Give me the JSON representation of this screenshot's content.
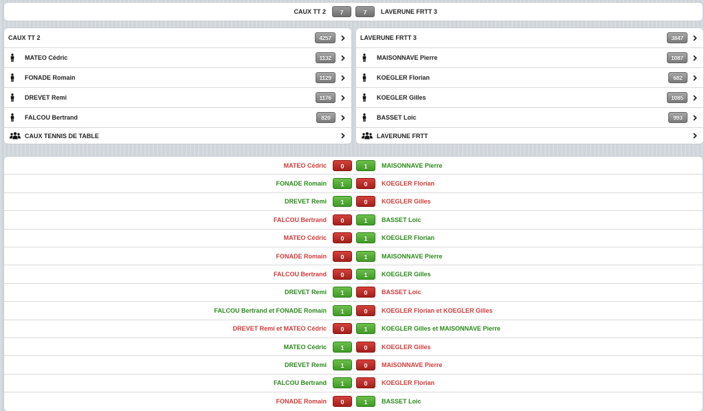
{
  "header": {
    "home": "CAUX TT 2",
    "home_score": "7",
    "away_score": "7",
    "away": "LAVERUNE FRTT 3"
  },
  "teams": {
    "left": {
      "name": "CAUX TT 2",
      "points": "4257",
      "players": [
        {
          "name": "MATEO Cédric",
          "points": "1132"
        },
        {
          "name": "FONADE Romain",
          "points": "1129"
        },
        {
          "name": "DREVET Remi",
          "points": "1176"
        },
        {
          "name": "FALCOU Bertrand",
          "points": "820"
        }
      ],
      "club": "CAUX TENNIS DE TABLE"
    },
    "right": {
      "name": "LAVERUNE FRTT 3",
      "points": "3847",
      "players": [
        {
          "name": "MAISONNAVE Pierre",
          "points": "1087"
        },
        {
          "name": "KOEGLER Florian",
          "points": "682"
        },
        {
          "name": "KOEGLER Gilles",
          "points": "1085"
        },
        {
          "name": "BASSET Loic",
          "points": "993"
        }
      ],
      "club": "LAVERUNE FRTT"
    }
  },
  "matches": [
    {
      "home": "MATEO Cédric",
      "hs": "0",
      "as": "1",
      "away": "MAISONNAVE Pierre",
      "winner": "away"
    },
    {
      "home": "FONADE Romain",
      "hs": "1",
      "as": "0",
      "away": "KOEGLER Florian",
      "winner": "home"
    },
    {
      "home": "DREVET Remi",
      "hs": "1",
      "as": "0",
      "away": "KOEGLER Gilles",
      "winner": "home"
    },
    {
      "home": "FALCOU Bertrand",
      "hs": "0",
      "as": "1",
      "away": "BASSET Loic",
      "winner": "away"
    },
    {
      "home": "MATEO Cédric",
      "hs": "0",
      "as": "1",
      "away": "KOEGLER Florian",
      "winner": "away"
    },
    {
      "home": "FONADE Romain",
      "hs": "0",
      "as": "1",
      "away": "MAISONNAVE Pierre",
      "winner": "away"
    },
    {
      "home": "FALCOU Bertrand",
      "hs": "0",
      "as": "1",
      "away": "KOEGLER Gilles",
      "winner": "away"
    },
    {
      "home": "DREVET Remi",
      "hs": "1",
      "as": "0",
      "away": "BASSET Loic",
      "winner": "home"
    },
    {
      "home": "FALCOU Bertrand et FONADE Romain",
      "hs": "1",
      "as": "0",
      "away": "KOEGLER Florian et KOEGLER Gilles",
      "winner": "home"
    },
    {
      "home": "DREVET Remi et MATEO Cédric",
      "hs": "0",
      "as": "1",
      "away": "KOEGLER Gilles et MAISONNAVE Pierre",
      "winner": "away"
    },
    {
      "home": "MATEO Cédric",
      "hs": "1",
      "as": "0",
      "away": "KOEGLER Gilles",
      "winner": "home"
    },
    {
      "home": "DREVET Remi",
      "hs": "1",
      "as": "0",
      "away": "MAISONNAVE Pierre",
      "winner": "home"
    },
    {
      "home": "FALCOU Bertrand",
      "hs": "1",
      "as": "0",
      "away": "KOEGLER Florian",
      "winner": "home"
    },
    {
      "home": "FONADE Romain",
      "hs": "0",
      "as": "1",
      "away": "BASSET Loic",
      "winner": "away"
    }
  ],
  "icons": {
    "player": "person-icon",
    "club": "group-icon",
    "chevron": "chevron-right-icon"
  },
  "colors": {
    "win": "#2a8a1a",
    "lose": "#d23a3a",
    "badge": "#7a7a7a"
  }
}
